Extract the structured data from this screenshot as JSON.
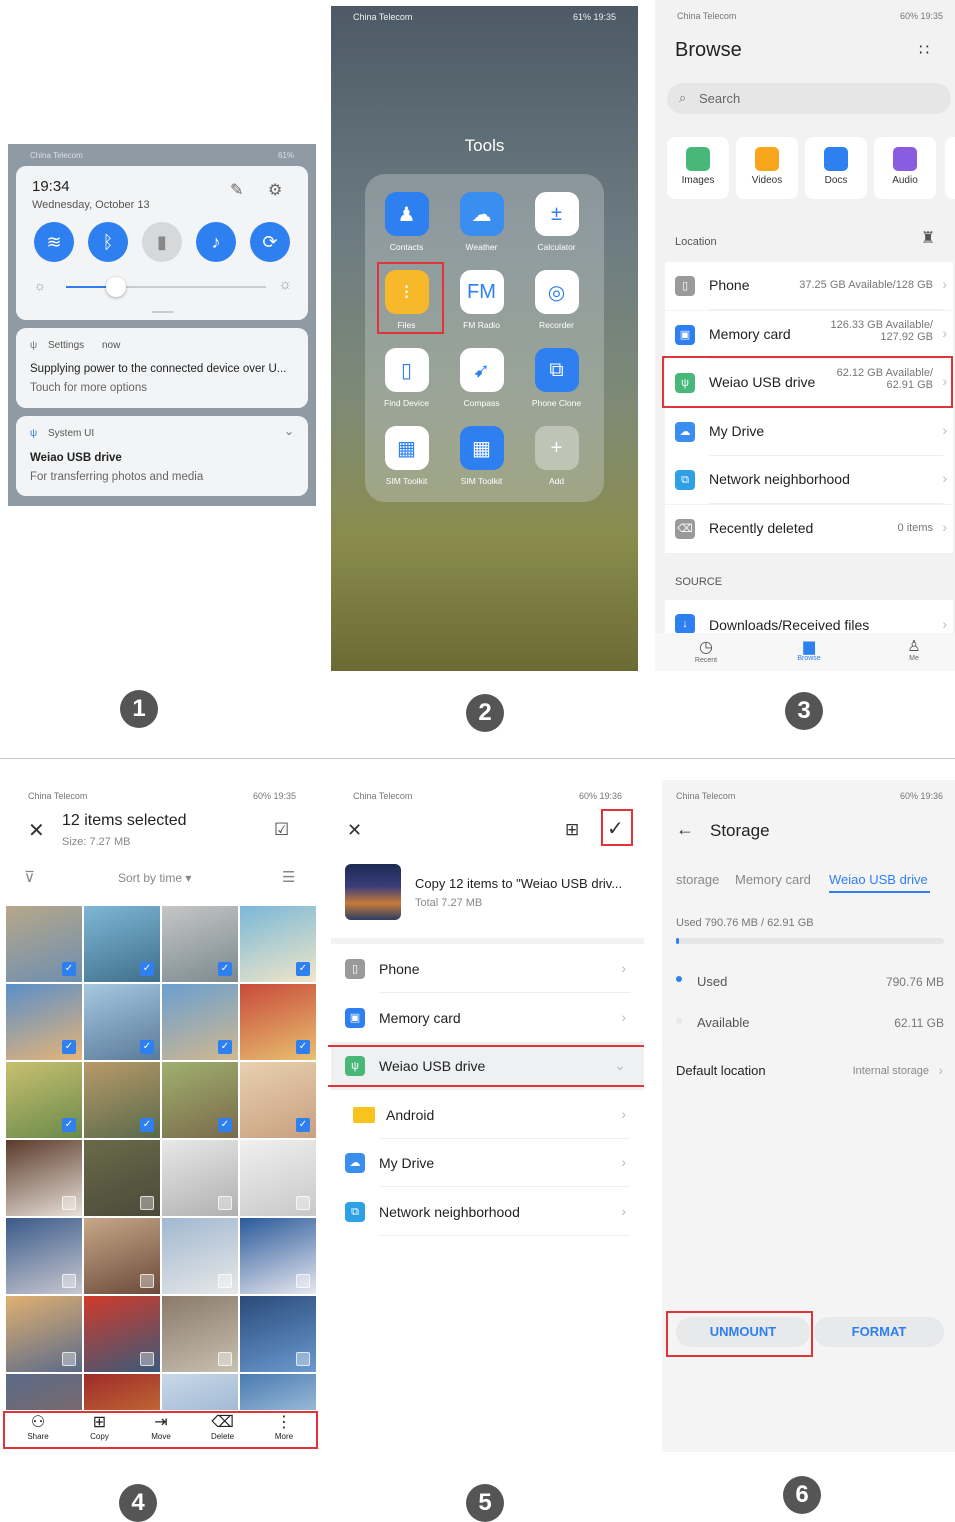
{
  "steps": [
    "1",
    "2",
    "3",
    "4",
    "5",
    "6"
  ],
  "panel1": {
    "status_left": "China Telecom",
    "status_right": "61%",
    "time": "19:34",
    "date": "Wednesday, October 13",
    "notif1_app": "Settings",
    "notif1_when": "now",
    "notif1_title": "Supplying power to the connected device over U...",
    "notif1_sub": "Touch for more options",
    "notif2_app": "System UI",
    "notif2_title": "Weiao USB drive",
    "notif2_sub": "For transferring photos and media"
  },
  "panel2": {
    "status_left": "China Telecom",
    "status_right": "61%  19:35",
    "folder_title": "Tools",
    "apps": [
      {
        "label": "Contacts",
        "icon": "contacts-icon",
        "color": "#2e7ff0"
      },
      {
        "label": "Weather",
        "icon": "weather-icon",
        "color": "#3a8ef0"
      },
      {
        "label": "Calculator",
        "icon": "calculator-icon",
        "color": "#fff"
      },
      {
        "label": "Files",
        "icon": "files-icon",
        "color": "#f7b829"
      },
      {
        "label": "FM Radio",
        "icon": "fm-radio-icon",
        "color": "#fff"
      },
      {
        "label": "Recorder",
        "icon": "recorder-icon",
        "color": "#fff"
      },
      {
        "label": "Find Device",
        "icon": "find-device-icon",
        "color": "#fff"
      },
      {
        "label": "Compass",
        "icon": "compass-icon",
        "color": "#fff"
      },
      {
        "label": "Phone Clone",
        "icon": "phone-clone-icon",
        "color": "#2e7ff0"
      },
      {
        "label": "SIM Toolkit",
        "icon": "sim-toolkit-icon",
        "color": "#fff"
      },
      {
        "label": "SIM Toolkit",
        "icon": "sim-toolkit-icon",
        "color": "#2e7ff0"
      },
      {
        "label": "Add",
        "icon": "add-icon",
        "color": "rgba(255,255,255,0.35)"
      }
    ]
  },
  "panel3": {
    "status_left": "China Telecom",
    "status_right": "60%  19:35",
    "title": "Browse",
    "search_placeholder": "Search",
    "tiles": [
      {
        "label": "Images",
        "color": "#48b878"
      },
      {
        "label": "Videos",
        "color": "#f7a61c"
      },
      {
        "label": "Docs",
        "color": "#2e7ff0"
      },
      {
        "label": "Audio",
        "color": "#8a5ce0"
      }
    ],
    "location_label": "Location",
    "locations": [
      {
        "name": "Phone",
        "val1": "37.25 GB Available/128 GB",
        "val2": "",
        "color": "#9a9a9a"
      },
      {
        "name": "Memory card",
        "val1": "126.33 GB Available/",
        "val2": "127.92 GB",
        "color": "#2e7ff0"
      },
      {
        "name": "Weiao USB drive",
        "val1": "62.12 GB Available/",
        "val2": "62.91 GB",
        "color": "#48b878"
      },
      {
        "name": "My Drive",
        "val1": "",
        "val2": "",
        "color": "#3a8ef0"
      },
      {
        "name": "Network neighborhood",
        "val1": "",
        "val2": "",
        "color": "#2ea0e6"
      },
      {
        "name": "Recently deleted",
        "val1": "0 items",
        "val2": "",
        "color": "#9a9a9a"
      }
    ],
    "source_label": "SOURCE",
    "source_item": "Downloads/Received files",
    "nav": [
      "Recent",
      "Browse",
      "Me"
    ]
  },
  "panel4": {
    "status_left": "China Telecom",
    "status_right": "60%  19:35",
    "title": "12 items selected",
    "size": "Size: 7.27 MB",
    "sort": "Sort by time",
    "toolbar": [
      "Share",
      "Copy",
      "Move",
      "Delete",
      "More"
    ]
  },
  "panel5": {
    "status_left": "China Telecom",
    "status_right": "60%  19:36",
    "copy_title": "Copy 12 items to \"Weiao USB driv...",
    "copy_total": "Total 7.27 MB",
    "rows": [
      {
        "name": "Phone",
        "color": "#9a9a9a"
      },
      {
        "name": "Memory card",
        "color": "#2e7ff0"
      },
      {
        "name": "Weiao USB drive",
        "color": "#48b878"
      },
      {
        "name": "Android",
        "color": "#f7c31c"
      },
      {
        "name": "My Drive",
        "color": "#3a8ef0"
      },
      {
        "name": "Network neighborhood",
        "color": "#2ea0e6"
      }
    ]
  },
  "panel6": {
    "status_left": "China Telecom",
    "status_right": "60%  19:36",
    "title": "Storage",
    "tabs": [
      "storage",
      "Memory card",
      "Weiao USB drive"
    ],
    "used_summary": "Used 790.76 MB / 62.91 GB",
    "used_fraction": 0.0126,
    "used_label": "Used",
    "used_value": "790.76 MB",
    "available_label": "Available",
    "available_value": "62.11 GB",
    "default_label": "Default location",
    "default_value": "Internal storage",
    "unmount": "UNMOUNT",
    "format": "FORMAT"
  }
}
